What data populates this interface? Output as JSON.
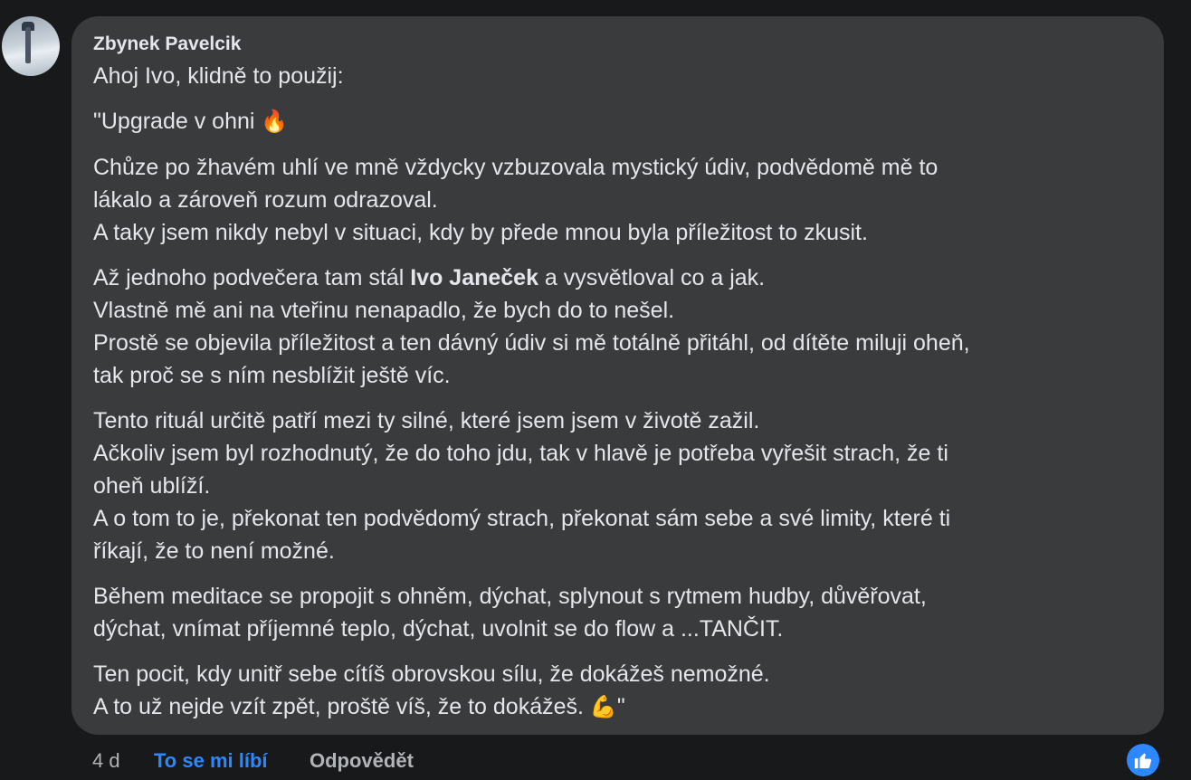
{
  "comment": {
    "author": "Zbynek Pavelcik",
    "paragraphs": [
      {
        "lines": [
          {
            "text": "Ahoj Ivo, klidně to použij:"
          }
        ]
      },
      {
        "lines": [
          {
            "text": "\"Upgrade v ohni",
            "emoji": "🔥"
          }
        ]
      },
      {
        "lines": [
          {
            "text": "Chůze po žhavém uhlí ve mně vždycky vzbuzovala mystický údiv, podvědomě mě to"
          },
          {
            "text": "lákalo a zároveň rozum odrazoval."
          },
          {
            "text": "A taky jsem nikdy nebyl v situaci, kdy by přede mnou byla příležitost to zkusit."
          }
        ]
      },
      {
        "lines": [
          {
            "before": "Až jednoho podvečera tam stál ",
            "bold": "Ivo Janeček",
            "after": " a vysvětloval co a jak."
          },
          {
            "text": "Vlastně mě ani na vteřinu nenapadlo, že bych do to nešel."
          },
          {
            "text": "Prostě se objevila příležitost a ten dávný údiv si mě totálně přitáhl, od dítěte miluji oheň,"
          },
          {
            "text": "tak proč se s ním nesblížit ještě víc."
          }
        ]
      },
      {
        "lines": [
          {
            "text": "Tento rituál určitě patří mezi ty silné, které jsem jsem v životě zažil."
          },
          {
            "text": "Ačkoliv jsem byl rozhodnutý, že do toho jdu, tak v hlavě je potřeba vyřešit strach, že ti"
          },
          {
            "text": "oheň ublíží."
          },
          {
            "text": "A o tom to je, překonat ten podvědomý strach, překonat sám sebe a své limity, které ti"
          },
          {
            "text": "říkají, že to není možné."
          }
        ]
      },
      {
        "lines": [
          {
            "text": "Během meditace se propojit s ohněm, dýchat, splynout s rytmem hudby, důvěřovat,"
          },
          {
            "text": "dýchat, vnímat příjemné teplo, dýchat, uvolnit se do flow a ...TANČIT."
          }
        ]
      },
      {
        "lines": [
          {
            "text": "Ten pocit, kdy unitř sebe cítíš obrovskou sílu, že dokážeš nemožné."
          },
          {
            "text": "A to už nejde vzít zpět, proště víš, že to dokážeš.",
            "emoji": "💪",
            "after": "\""
          }
        ]
      }
    ],
    "actions": {
      "time": "4 d",
      "like_label": "To se mi líbí",
      "reply_label": "Odpovědět"
    },
    "reaction_icon": "thumbs-up-icon"
  },
  "colors": {
    "background": "#18191a",
    "bubble": "#3a3b3c",
    "text": "#e4e6eb",
    "secondary": "#b0b3b8",
    "accent": "#2d88ff"
  }
}
